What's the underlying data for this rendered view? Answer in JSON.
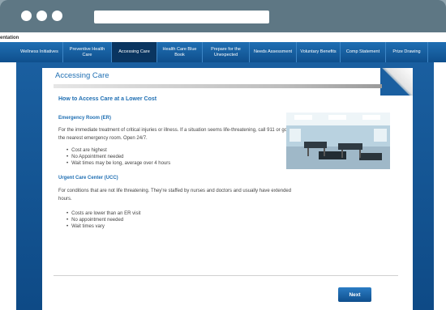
{
  "app": {
    "label": "entation"
  },
  "nav": {
    "items": [
      {
        "label": "Wellness Initiatives",
        "active": false
      },
      {
        "label": "Preventive Health Care",
        "active": false
      },
      {
        "label": "Accessing Care",
        "active": true
      },
      {
        "label": "Health Care Blue Book",
        "active": false
      },
      {
        "label": "Prepare for the Unexpected",
        "active": false
      },
      {
        "label": "Needs Assessment",
        "active": false
      },
      {
        "label": "Voluntary Benefits",
        "active": false
      },
      {
        "label": "Comp Statement",
        "active": false
      },
      {
        "label": "Prize Drawing",
        "active": false
      }
    ]
  },
  "page": {
    "title": "Accessing Care",
    "heading": "How to Access Care at a Lower Cost",
    "sections": [
      {
        "title": "Emergency Room (ER)",
        "body": "For the immediate treatment of critical injuries or illness. If a situation seems life-threatening, call 911 or go to the nearest emergency room. Open 24/7.",
        "bullets": [
          "Cost are highest",
          "No Appointment needed",
          "Wait times may be long, average over 4 hours"
        ]
      },
      {
        "title": "Urgent Care Center (UCC)",
        "body": "For conditions that are not life threatening. They're staffed by nurses and doctors and usually have extended hours.",
        "bullets": [
          "Costs are lower than an ER visit",
          "No appointment needed",
          "Wait times vary"
        ]
      }
    ],
    "next_label": "Next"
  },
  "colors": {
    "accent": "#1f6fb3",
    "nav_dark": "#0a3560",
    "window_frame": "#6c8592"
  }
}
